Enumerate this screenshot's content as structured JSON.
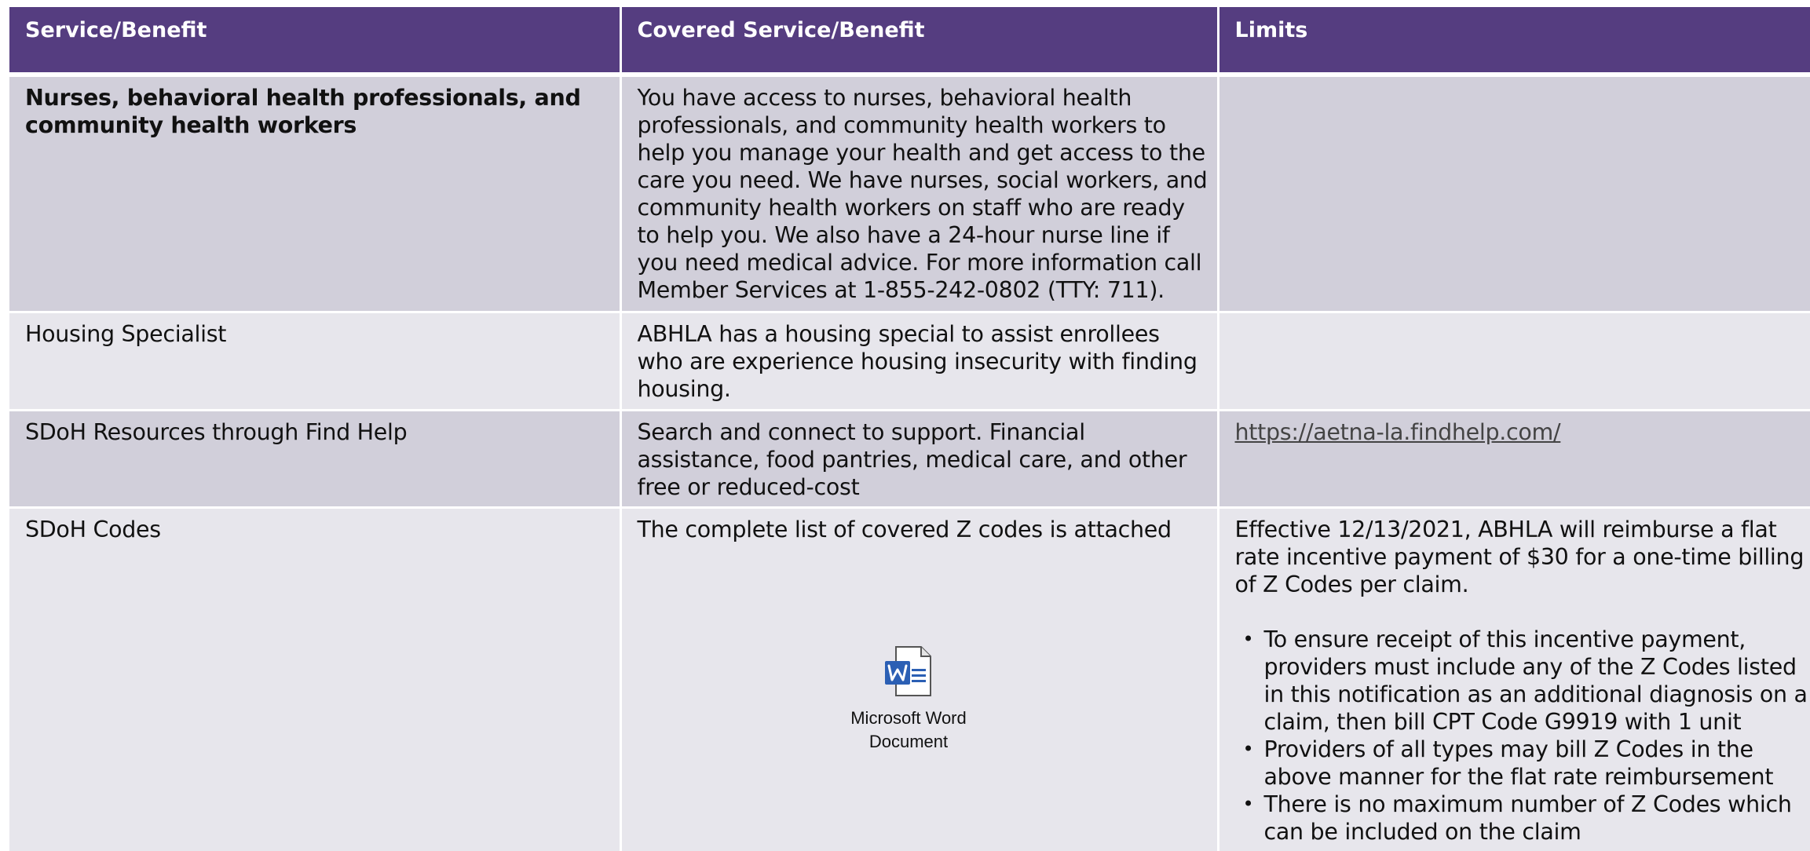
{
  "table": {
    "headers": {
      "service": "Service/Benefit",
      "covered": "Covered Service/Benefit",
      "limits": "Limits"
    },
    "rows": [
      {
        "service": "Nurses, behavioral health professionals, and community health workers",
        "covered": "You have access to nurses, behavioral health professionals, and community health workers to help you manage your health and get access to the care you need. We have nurses, social workers, and community health workers on staff who are ready to help you. We also have a 24-hour nurse line if you need medical advice. For more information call Member Services at 1-855-242-0802 (TTY: 711).",
        "limits": ""
      },
      {
        "service": "Housing Specialist",
        "covered": "ABHLA has a housing special to assist enrollees who are experience housing insecurity with finding housing.",
        "limits": ""
      },
      {
        "service": "SDoH Resources through Find Help",
        "covered": "Search and connect to support. Financial assistance, food pantries, medical care, and other free or reduced-cost",
        "limits_link": "https://aetna-la.findhelp.com/"
      },
      {
        "service": "SDoH Codes",
        "covered": "The complete list of covered Z codes is attached",
        "limits_intro": "Effective 12/13/2021, ABHLA will reimburse a flat rate incentive payment of $30 for a one-time billing of Z Codes per claim.",
        "limits_bullets": [
          "To ensure receipt of this incentive payment, providers must include any of the Z Codes listed in this notification as an additional diagnosis on a claim, then bill CPT Code G9919 with 1 unit",
          "Providers of all types may bill Z Codes in the above manner for the flat rate reimbursement",
          "There is no maximum number of Z Codes which can be included on the claim"
        ],
        "attachment": {
          "icon": "word-document-icon",
          "line1": "Microsoft Word",
          "line2": "Document"
        }
      }
    ]
  },
  "colors": {
    "header_bg": "#553d80",
    "row_dark": "#d1cfda",
    "row_light": "#e7e6ec",
    "word_blue": "#2b5fb4"
  }
}
